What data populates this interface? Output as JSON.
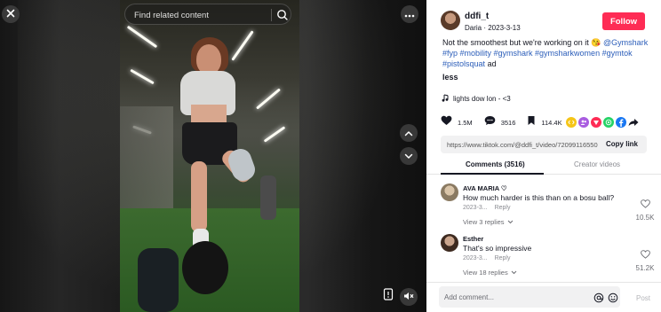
{
  "viewer": {
    "search_placeholder": "Find related content"
  },
  "author": {
    "username": "ddfi_t",
    "subline": "Daria · 2023-3-13",
    "follow_label": "Follow"
  },
  "caption": {
    "text": "Not the smoothest but we're working on it ",
    "emoji": "😘",
    "mention": "@Gymshark",
    "tags_line2": "#fyp #mobility #gymshark #gymsharkwomen #gymtok",
    "tags_line3": "#pistolsquat",
    "ad_label": "ad",
    "less_label": "less"
  },
  "music": {
    "title": "lights dow lon - <3"
  },
  "stats": {
    "likes": "1.5M",
    "comments": "3516",
    "saves": "114.4K"
  },
  "share_icons": [
    "embed-icon",
    "friends-icon",
    "send-icon",
    "whatsapp-icon",
    "facebook-icon",
    "arrow-share-icon"
  ],
  "link": {
    "url": "https://www.tiktok.com/@ddfi_t/video/7209911655080...",
    "copy_label": "Copy link"
  },
  "tabs": {
    "comments": "Comments (3516)",
    "creator": "Creator videos"
  },
  "comments": [
    {
      "name": "AVA MARIA ♡",
      "text": "How much harder is this than on a bosu ball?",
      "date": "2023-3...",
      "reply_label": "Reply",
      "replies": "View 3 replies",
      "likes": "10.5K"
    },
    {
      "name": "Esther",
      "text": "That's so impressive",
      "date": "2023-3...",
      "reply_label": "Reply",
      "replies": "View 18 replies",
      "likes": "51.2K"
    }
  ],
  "comment_bar": {
    "placeholder": "Add comment...",
    "post_label": "Post"
  },
  "colors": {
    "follow": "#fe2c55",
    "hashtag": "#2b5db9",
    "text": "#161823"
  }
}
